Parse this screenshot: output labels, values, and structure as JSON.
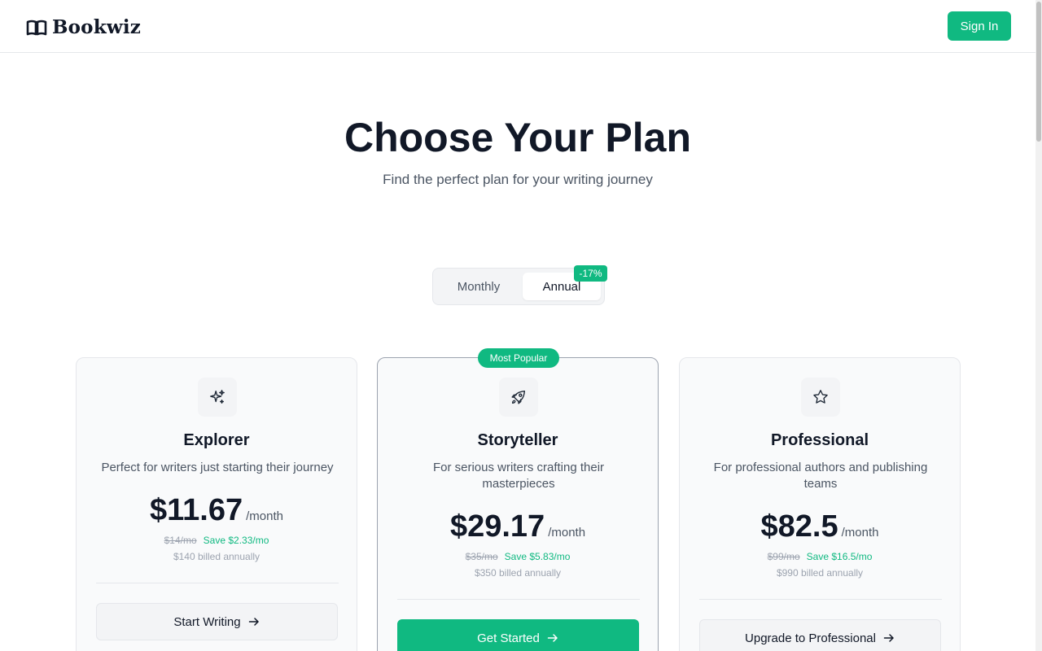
{
  "header": {
    "brand": "Bookwiz",
    "signin_label": "Sign In"
  },
  "hero": {
    "title": "Choose Your Plan",
    "subtitle": "Find the perfect plan for your writing journey"
  },
  "billing_toggle": {
    "monthly_label": "Monthly",
    "annual_label": "Annual",
    "selected": "Annual",
    "discount_badge": "-17%"
  },
  "plans": [
    {
      "icon": "sparkles-icon",
      "name": "Explorer",
      "description": "Perfect for writers just starting their journey",
      "price": "$11.67",
      "period": "/month",
      "original_price": "$14/mo",
      "savings": "Save $2.33/mo",
      "billed": "$140 billed annually",
      "cta": "Start Writing",
      "popular": false
    },
    {
      "icon": "rocket-icon",
      "name": "Storyteller",
      "description": "For serious writers crafting their masterpieces",
      "price": "$29.17",
      "period": "/month",
      "original_price": "$35/mo",
      "savings": "Save $5.83/mo",
      "billed": "$350 billed annually",
      "cta": "Get Started",
      "popular": true,
      "popular_label": "Most Popular"
    },
    {
      "icon": "star-icon",
      "name": "Professional",
      "description": "For professional authors and publishing teams",
      "price": "$82.5",
      "period": "/month",
      "original_price": "$99/mo",
      "savings": "Save $16.5/mo",
      "billed": "$990 billed annually",
      "cta": "Upgrade to Professional",
      "popular": false
    }
  ],
  "colors": {
    "accent": "#10b981",
    "text": "#111827",
    "muted": "#4b5563"
  }
}
